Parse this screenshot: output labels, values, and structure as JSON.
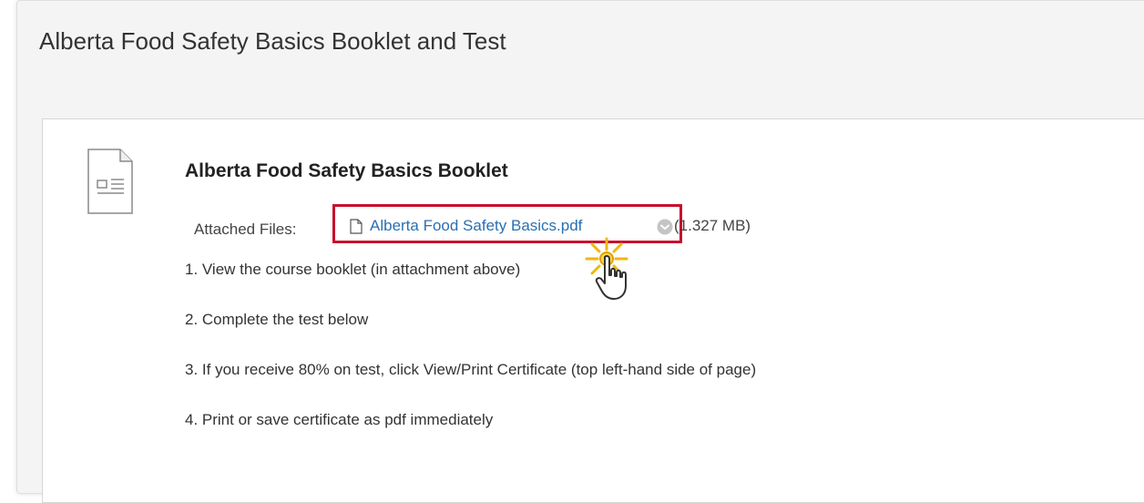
{
  "page": {
    "title": "Alberta Food Safety Basics Booklet and Test"
  },
  "item": {
    "icon": "document-icon",
    "title": "Alberta Food Safety Basics Booklet",
    "attached_files_label": "Attached Files:",
    "file": {
      "icon": "file-icon",
      "name": "Alberta Food Safety Basics.pdf",
      "menu_icon": "chevron-down-circle-icon",
      "size": "(1.327 MB)"
    },
    "steps": [
      "1. View the course booklet (in attachment above)",
      "2. Complete the test below",
      "3. If you receive 80% on test, click View/Print Certificate (top left-hand side of page)",
      "4. Print or save certificate as pdf immediately"
    ]
  },
  "colors": {
    "link": "#2a6fb0",
    "highlight_border": "#c8102e",
    "panel_bg": "#f4f4f4",
    "click_burst": "#f2b705"
  }
}
